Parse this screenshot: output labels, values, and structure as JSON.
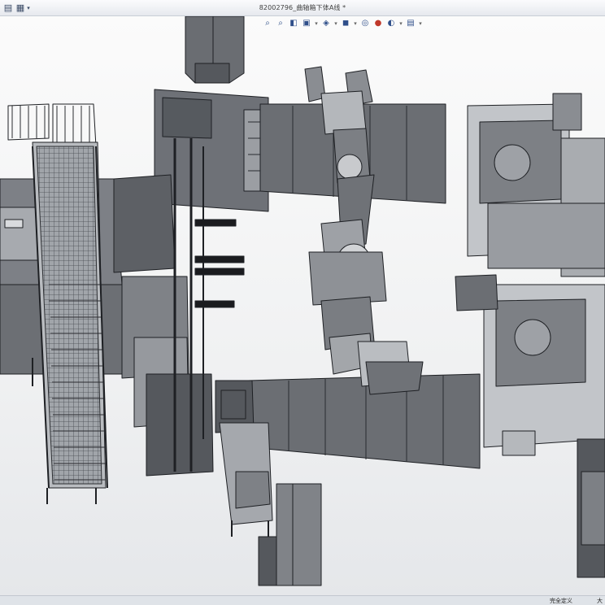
{
  "window": {
    "title": "82002796_曲轴箱下体A线 *"
  },
  "titlebar_icons": [
    "app-icon",
    "document-properties-icon",
    "dropdown-arrow-icon"
  ],
  "heads_up_toolbar": [
    {
      "name": "zoom-to-fit-icon",
      "glyph": "⌕"
    },
    {
      "name": "zoom-to-area-icon",
      "glyph": "⌕"
    },
    {
      "name": "previous-view-icon",
      "glyph": "◧"
    },
    {
      "name": "section-view-icon",
      "glyph": "▣"
    },
    {
      "name": "view-orientation-icon",
      "glyph": "◈"
    },
    {
      "name": "display-style-icon",
      "glyph": "◼"
    },
    {
      "name": "hide-show-items-icon",
      "glyph": "◎"
    },
    {
      "name": "edit-appearance-icon",
      "glyph": "●"
    },
    {
      "name": "apply-scene-icon",
      "glyph": "◐"
    },
    {
      "name": "view-settings-icon",
      "glyph": "▤"
    }
  ],
  "status_bar": {
    "state": "完全定义",
    "units": "大"
  },
  "colors": {
    "model_dark": "#4e5156",
    "model_mid": "#8b8f95",
    "model_light": "#c4c7cb",
    "edge": "#1e2024",
    "background_top": "#fbfbfb",
    "background_bottom": "#e5e7ea"
  }
}
